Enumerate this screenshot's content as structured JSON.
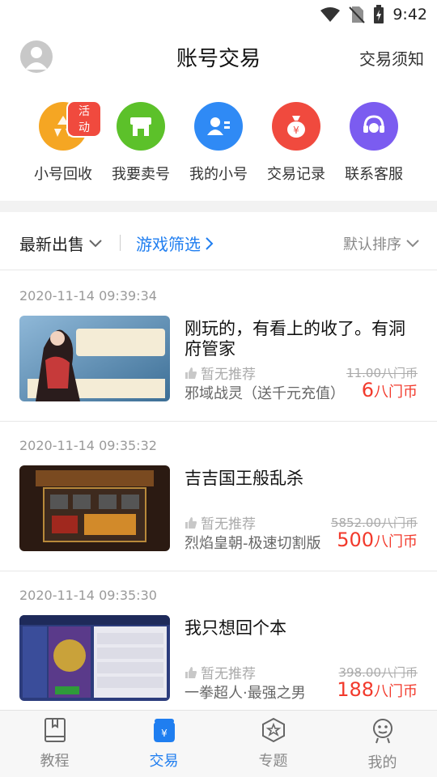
{
  "status_bar": {
    "time": "9:42"
  },
  "header": {
    "title": "账号交易",
    "notice_link": "交易须知"
  },
  "actions": [
    {
      "label": "小号回收",
      "icon": "recycle-icon",
      "color": "#f5a623",
      "badge": "活动"
    },
    {
      "label": "我要卖号",
      "icon": "shop-icon",
      "color": "#5cc12a"
    },
    {
      "label": "我的小号",
      "icon": "account-card-icon",
      "color": "#2f8af5"
    },
    {
      "label": "交易记录",
      "icon": "money-bag-icon",
      "color": "#f04a3e"
    },
    {
      "label": "联系客服",
      "icon": "headset-icon",
      "color": "#7b5cf0"
    }
  ],
  "filters": {
    "latest": "最新出售",
    "game_filter": "游戏筛选",
    "sort": "默认排序"
  },
  "listings": [
    {
      "timestamp": "2020-11-14 09:39:34",
      "title": "刚玩的，有看上的收了。有洞府管家",
      "recommend": "暂无推荐",
      "game": "邪域战灵（送千元充值）",
      "original_price": "11.00八门币",
      "price": "6",
      "unit": "八门币"
    },
    {
      "timestamp": "2020-11-14 09:35:32",
      "title": "吉吉国王般乱杀",
      "recommend": "暂无推荐",
      "game": "烈焰皇朝-极速切割版",
      "original_price": "5852.00八门币",
      "price": "500",
      "unit": "八门币"
    },
    {
      "timestamp": "2020-11-14 09:35:30",
      "title": "我只想回个本",
      "recommend": "暂无推荐",
      "game": "一拳超人·最强之男",
      "original_price": "398.00八门币",
      "price": "188",
      "unit": "八门币"
    }
  ],
  "bottom_nav": [
    {
      "label": "教程",
      "icon": "book-icon",
      "active": false
    },
    {
      "label": "交易",
      "icon": "wallet-icon",
      "active": true
    },
    {
      "label": "专题",
      "icon": "star-badge-icon",
      "active": false
    },
    {
      "label": "我的",
      "icon": "smile-face-icon",
      "active": false
    }
  ],
  "colors": {
    "accent": "#1f7ef0",
    "price": "#f23a2c"
  }
}
